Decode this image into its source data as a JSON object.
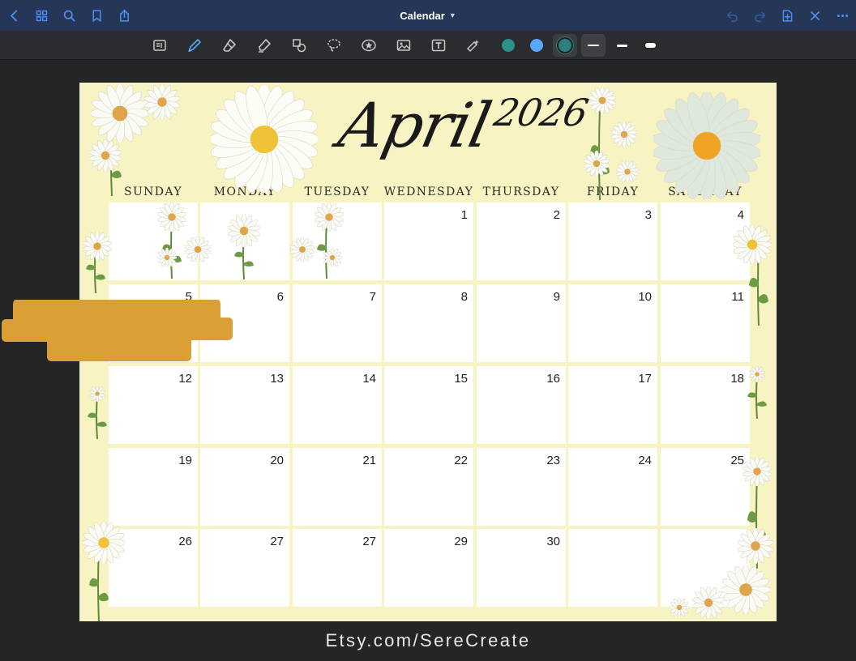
{
  "nav": {
    "title": "Calendar",
    "left_icons": [
      "back-chevron-icon",
      "grid-icon",
      "search-icon",
      "bookmark-icon",
      "share-icon"
    ],
    "right_icons": [
      "undo-icon",
      "redo-icon",
      "add-page-icon",
      "close-icon",
      "more-icon"
    ]
  },
  "toolbar": {
    "tools": [
      "reader-icon",
      "pen-icon",
      "eraser-icon",
      "highlighter-icon",
      "shapes-icon",
      "lasso-icon",
      "sticker-icon",
      "image-icon",
      "text-icon",
      "laser-pointer-icon"
    ],
    "colors": [
      "#2f8f8a",
      "#5aa7ff",
      "#2c7f7a"
    ],
    "selected_color_index": 2,
    "selected_stroke_index": 0
  },
  "calendar": {
    "month": "April",
    "year": "2026",
    "weekdays": [
      "SUNDAY",
      "MONDAY",
      "TUESDAY",
      "WEDNESDAY",
      "THURSDAY",
      "FRIDAY",
      "SATURDAY"
    ],
    "weeks": [
      [
        "",
        "",
        "",
        "1",
        "2",
        "3",
        "4"
      ],
      [
        "5",
        "6",
        "7",
        "8",
        "9",
        "10",
        "11"
      ],
      [
        "12",
        "13",
        "14",
        "15",
        "16",
        "17",
        "18"
      ],
      [
        "19",
        "20",
        "21",
        "22",
        "23",
        "24",
        "25"
      ],
      [
        "26",
        "27",
        "27",
        "29",
        "30",
        "",
        ""
      ]
    ]
  },
  "footer": {
    "text": "Etsy.com/SereCreate"
  },
  "colors": {
    "navbar": "#253656",
    "accent_blue": "#4d8ff0",
    "page_bg": "#f8f3c2",
    "highlight": "#dba035"
  }
}
